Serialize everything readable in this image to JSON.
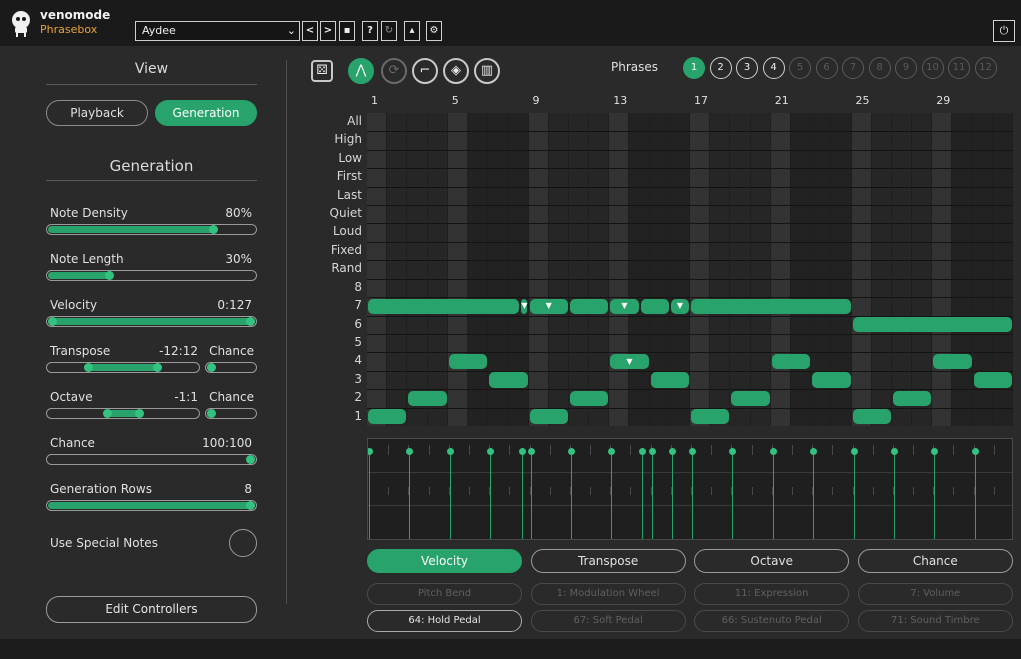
{
  "app": {
    "brand": "venomode",
    "product": "Phrasebox"
  },
  "preset": {
    "name": "Aydee",
    "caret": "⌄"
  },
  "toolbar_buttons": [
    "<",
    ">",
    "▪",
    "?",
    "↻",
    "▴",
    "⚙"
  ],
  "power_icon": "⏻",
  "view": {
    "title": "View",
    "tabs": [
      {
        "label": "Playback",
        "active": false
      },
      {
        "label": "Generation",
        "active": true
      }
    ]
  },
  "generation": {
    "title": "Generation",
    "params": {
      "note_density": {
        "label": "Note Density",
        "value": "80%",
        "level": 0.8
      },
      "note_length": {
        "label": "Note Length",
        "value": "30%",
        "level": 0.3
      },
      "velocity": {
        "label": "Velocity",
        "value": "0:127",
        "range": [
          0,
          1
        ]
      },
      "transpose": {
        "label": "Transpose",
        "value": "-12:12",
        "chance_label": "Chance"
      },
      "octave": {
        "label": "Octave",
        "value": "-1:1",
        "chance_label": "Chance"
      },
      "chance": {
        "label": "Chance",
        "value": "100:100"
      },
      "generation_rows": {
        "label": "Generation Rows",
        "value": "8"
      }
    },
    "use_special_notes": {
      "label": "Use Special Notes",
      "checked": false
    },
    "edit_controllers_label": "Edit Controllers"
  },
  "tools": [
    {
      "icon": "dice-icon",
      "glyph": "⚄",
      "state": "normal"
    },
    {
      "icon": "generate-icon",
      "glyph": "⋀",
      "state": "on"
    },
    {
      "icon": "cycle-icon",
      "glyph": "⟳",
      "state": "dim"
    },
    {
      "icon": "line-icon",
      "glyph": "⌐",
      "state": "normal"
    },
    {
      "icon": "eraser-icon",
      "glyph": "◈",
      "state": "normal"
    },
    {
      "icon": "piano-icon",
      "glyph": "▥",
      "state": "normal"
    }
  ],
  "phrases": {
    "label": "Phrases",
    "items": [
      {
        "n": "1",
        "state": "on"
      },
      {
        "n": "2",
        "state": "normal"
      },
      {
        "n": "3",
        "state": "normal"
      },
      {
        "n": "4",
        "state": "normal"
      },
      {
        "n": "5",
        "state": "dim"
      },
      {
        "n": "6",
        "state": "dim"
      },
      {
        "n": "7",
        "state": "dim"
      },
      {
        "n": "8",
        "state": "dim"
      },
      {
        "n": "9",
        "state": "dim"
      },
      {
        "n": "10",
        "state": "dim"
      },
      {
        "n": "11",
        "state": "dim"
      },
      {
        "n": "12",
        "state": "dim"
      }
    ]
  },
  "grid": {
    "bar_numbers": [
      "1",
      "5",
      "9",
      "13",
      "17",
      "21",
      "25",
      "29"
    ],
    "row_labels": [
      "All",
      "High",
      "Low",
      "First",
      "Last",
      "Quiet",
      "Loud",
      "Fixed",
      "Rand",
      "8",
      "7",
      "6",
      "5",
      "4",
      "3",
      "2",
      "1"
    ],
    "steps": 32,
    "notes": [
      {
        "row": "1",
        "start": 1,
        "length": 2
      },
      {
        "row": "2",
        "start": 3,
        "length": 2
      },
      {
        "row": "4",
        "start": 5,
        "length": 2
      },
      {
        "row": "3",
        "start": 7,
        "length": 2
      },
      {
        "row": "1",
        "start": 9,
        "length": 2
      },
      {
        "row": "2",
        "start": 11,
        "length": 2
      },
      {
        "row": "4",
        "start": 13,
        "length": 2,
        "marker": true
      },
      {
        "row": "3",
        "start": 15,
        "length": 2
      },
      {
        "row": "1",
        "start": 17,
        "length": 2
      },
      {
        "row": "2",
        "start": 19,
        "length": 2
      },
      {
        "row": "4",
        "start": 21,
        "length": 2
      },
      {
        "row": "3",
        "start": 23,
        "length": 2
      },
      {
        "row": "1",
        "start": 25,
        "length": 2
      },
      {
        "row": "2",
        "start": 27,
        "length": 2
      },
      {
        "row": "4",
        "start": 29,
        "length": 2
      },
      {
        "row": "3",
        "start": 31,
        "length": 2
      },
      {
        "row": "7",
        "start": 1,
        "length": 7.6
      },
      {
        "row": "7",
        "start": 8.6,
        "length": 0.4,
        "marker": true
      },
      {
        "row": "7",
        "start": 9,
        "length": 2,
        "marker": true
      },
      {
        "row": "7",
        "start": 11,
        "length": 2
      },
      {
        "row": "7",
        "start": 13,
        "length": 1.5,
        "marker": true
      },
      {
        "row": "7",
        "start": 14.5,
        "length": 1.5
      },
      {
        "row": "7",
        "start": 16,
        "length": 1,
        "marker": true
      },
      {
        "row": "7",
        "start": 17,
        "length": 8
      },
      {
        "row": "6",
        "start": 25,
        "length": 8
      }
    ]
  },
  "lane": {
    "velocity_steps": [
      1,
      3,
      5,
      7,
      8.6,
      9,
      11,
      13,
      14.5,
      15,
      16,
      17,
      19,
      21,
      23,
      25,
      27,
      29,
      31
    ],
    "velocity_level": 1.0
  },
  "controllers": {
    "main": [
      {
        "label": "Velocity",
        "active": true
      },
      {
        "label": "Transpose",
        "active": false
      },
      {
        "label": "Octave",
        "active": false
      },
      {
        "label": "Chance",
        "active": false
      }
    ],
    "secondary": [
      {
        "label": "Pitch Bend",
        "active": false
      },
      {
        "label": "1: Modulation Wheel",
        "active": false
      },
      {
        "label": "11: Expression",
        "active": false
      },
      {
        "label": "7: Volume",
        "active": false
      },
      {
        "label": "64: Hold Pedal",
        "active": true
      },
      {
        "label": "67: Soft Pedal",
        "active": false
      },
      {
        "label": "66: Sustenuto Pedal",
        "active": false
      },
      {
        "label": "71: Sound Timbre",
        "active": false
      }
    ]
  }
}
